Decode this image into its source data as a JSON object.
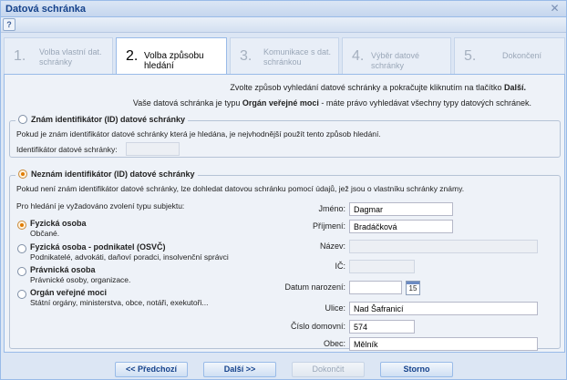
{
  "window": {
    "title": "Datová schránka"
  },
  "steps": [
    {
      "num": "1.",
      "label": "Volba vlastní dat. schránky"
    },
    {
      "num": "2.",
      "label": "Volba způsobu hledání"
    },
    {
      "num": "3.",
      "label": "Komunikace s dat. schránkou"
    },
    {
      "num": "4.",
      "label": "Výběr datové schránky"
    },
    {
      "num": "5.",
      "label": "Dokončení"
    }
  ],
  "info": {
    "line1_pre": "Zvolte způsob vyhledání datové schránky a pokračujte kliknutím na tlačítko ",
    "line1_bold": "Další.",
    "line2_pre": "Vaše datová schránka je typu ",
    "line2_bold": "Orgán veřejné moci",
    "line2_post": " - máte právo vyhledávat všechny typy datových schránek."
  },
  "known": {
    "legend": "Znám identifikátor (ID) datové schránky",
    "desc": "Pokud je znám identifikátor datové schránky která je hledána, je nejvhodnější použít tento způsob hledání.",
    "field_label": "Identifikátor datové schránky:",
    "field_value": ""
  },
  "unknown": {
    "legend": "Neznám identifikátor (ID) datové schránky",
    "desc": "Pokud není znám identifikátor datové schránky, lze dohledat datovou schránku pomocí údajů, jež jsou o vlastníku schránky známy.",
    "subject_prompt": "Pro hledání je vyžadováno zvolení typu subjektu:",
    "subjects": [
      {
        "title": "Fyzická osoba",
        "desc": "Občané."
      },
      {
        "title": "Fyzická osoba - podnikatel (OSVČ)",
        "desc": "Podnikatelé, advokáti, daňoví poradci, insolvenční správci"
      },
      {
        "title": "Právnická osoba",
        "desc": "Právnické osoby, organizace."
      },
      {
        "title": "Orgán veřejné moci",
        "desc": "Státní orgány, ministerstva, obce, notáři, exekutoři..."
      }
    ],
    "fields": {
      "jmeno_label": "Jméno:",
      "jmeno": "Dagmar",
      "prijmeni_label": "Příjmení:",
      "prijmeni": "Bradáčková",
      "nazev_label": "Název:",
      "nazev": "",
      "ic_label": "IČ:",
      "ic": "",
      "datum_label": "Datum narození:",
      "datum": "",
      "calendar": "15",
      "ulice_label": "Ulice:",
      "ulice": "Nad Šafranicí",
      "cislo_label": "Číslo domovní:",
      "cislo": "574",
      "obec_label": "Obec:",
      "obec": "Mělník"
    }
  },
  "buttons": {
    "prev": "<< Předchozí",
    "next": "Další >>",
    "finish": "Dokončit",
    "cancel": "Storno"
  },
  "icons": {
    "help": "help-icon",
    "close": "close-icon",
    "calendar": "calendar-icon"
  }
}
